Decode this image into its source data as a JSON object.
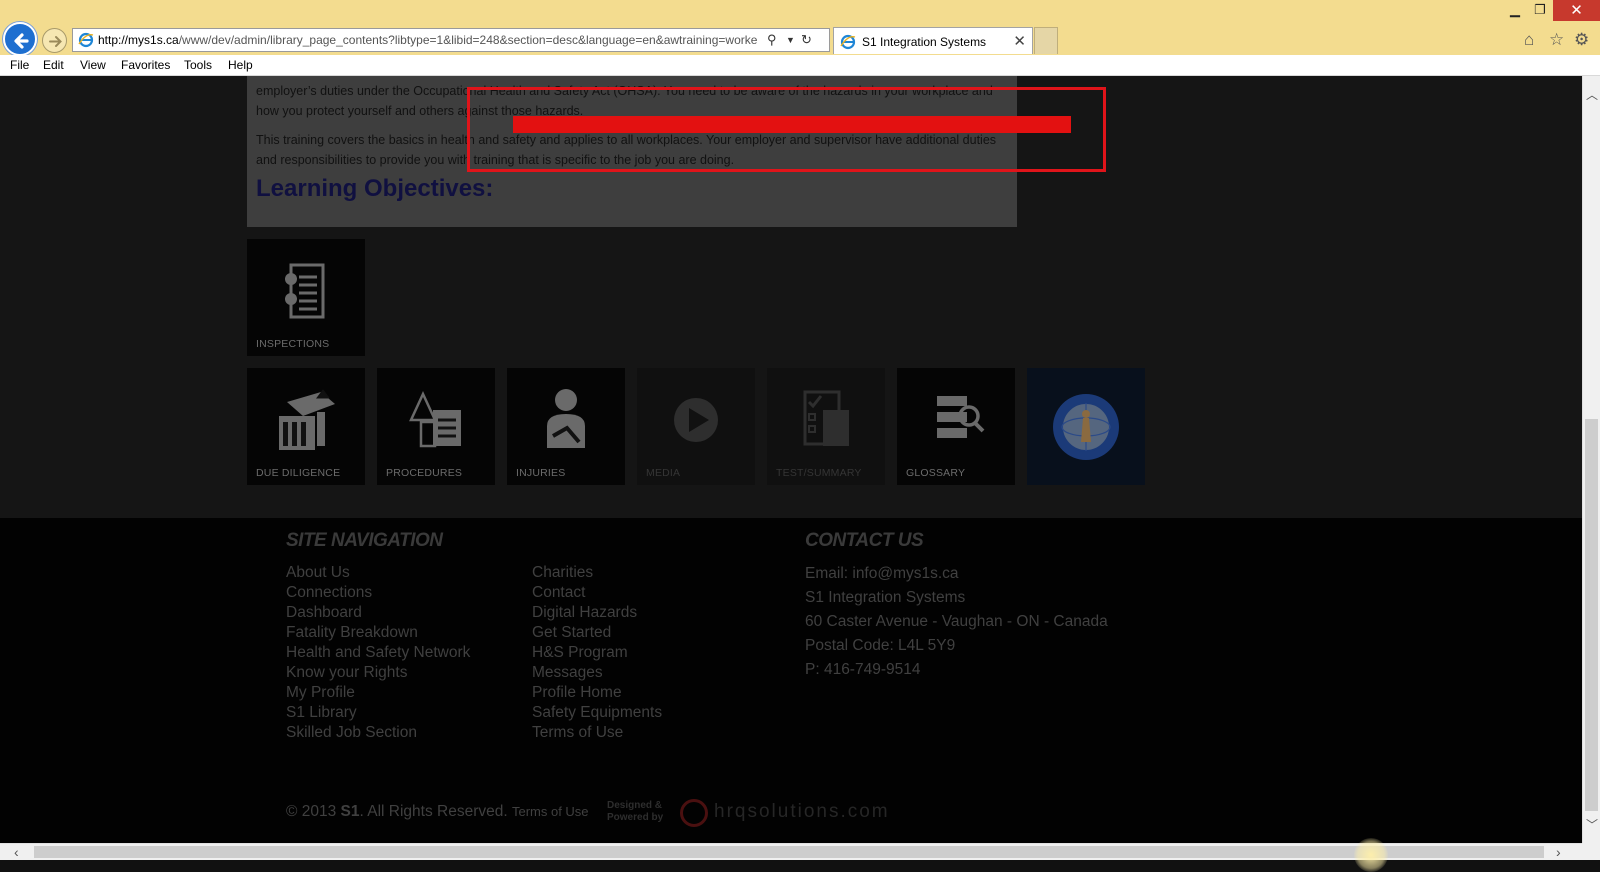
{
  "browser": {
    "url_host": "http://mys1s.ca",
    "url_path": "/www/dev/admin/library_page_contents?libtype=1&libid=248&section=desc&language=en&awtraining=worke",
    "tab_title": "S1 Integration Systems",
    "tab_close": "✕",
    "menu": [
      "File",
      "Edit",
      "View",
      "Favorites",
      "Tools",
      "Help"
    ]
  },
  "content": {
    "para1": "employer’s duties under the Occupational Health and Safety Act (OHSA). You need to be aware of the hazards in your workplace and how you protect yourself and others against those hazards.",
    "para2": "This training covers the basics in health and safety and applies to all workplaces. Your employer and supervisor have additional duties and responsibilities to provide you with training that is specific to the job you are doing.",
    "heading": "Learning Objectives:",
    "highlight_color": "#e0141a"
  },
  "tiles_row1": [
    {
      "label": "INSPECTIONS",
      "icon": "clipboard-checklist-icon"
    }
  ],
  "tiles_row2": [
    {
      "label": "DUE DILIGENCE",
      "icon": "documents-hazard-icon"
    },
    {
      "label": "PROCEDURES",
      "icon": "procedure-document-icon"
    },
    {
      "label": "INJURIES",
      "icon": "injured-person-icon"
    },
    {
      "label": "MEDIA",
      "icon": "play-icon"
    },
    {
      "label": "TEST/SUMMARY",
      "icon": "test-checklist-icon"
    },
    {
      "label": "GLOSSARY",
      "icon": "glossary-search-icon"
    }
  ],
  "footer": {
    "nav_heading": "SITE NAVIGATION",
    "nav_col1": [
      "About Us",
      "Connections",
      "Dashboard",
      "Fatality Breakdown",
      "Health and Safety Network",
      "Know your Rights",
      "My Profile",
      "S1 Library",
      "Skilled Job Section"
    ],
    "nav_col2": [
      "Charities",
      "Contact",
      "Digital Hazards",
      "Get Started",
      "H&S Program",
      "Messages",
      "Profile Home",
      "Safety Equipments",
      "Terms of Use"
    ],
    "contact_heading": "CONTACT US",
    "contact": [
      "Email: info@mys1s.ca",
      "S1 Integration Systems",
      "60 Caster Avenue - Vaughan - ON - Canada",
      "Postal Code: L4L 5Y9",
      "P: 416-749-9514"
    ],
    "copyright_pre": "© 2013 ",
    "copyright_brand": "S1",
    "copyright_post": ". All Rights Reserved. ",
    "terms": "Terms of Use",
    "designed_line1": "Designed &",
    "designed_line2": "Powered by",
    "hrq": "hrqsolutions.com"
  }
}
